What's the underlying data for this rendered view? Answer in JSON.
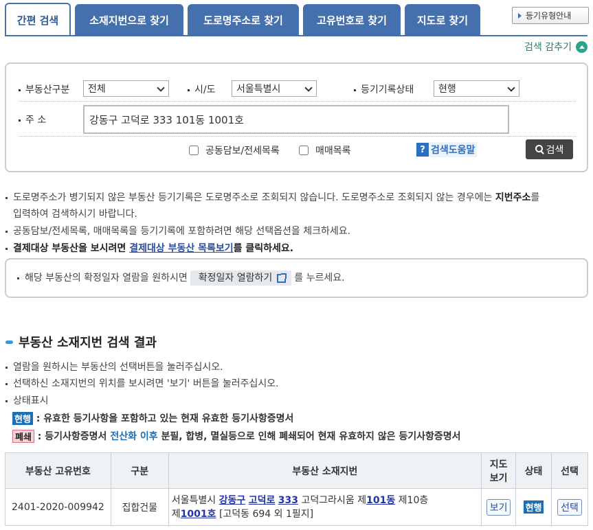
{
  "tabs": [
    {
      "label": "간편 검색"
    },
    {
      "label": "소재지번으로 찾기"
    },
    {
      "label": "도로명주소로 찾기"
    },
    {
      "label": "고유번호로 찾기"
    },
    {
      "label": "지도로 찾기"
    }
  ],
  "guide_button": "등기유형안내",
  "hide_search": "검색 감추기",
  "form": {
    "property_type_label": "부동산구분",
    "property_type_value": "전체",
    "sido_label": "시/도",
    "sido_value": "서울특별시",
    "record_status_label": "등기기록상태",
    "record_status_value": "현행",
    "address_label": "주 소",
    "address_value": "강동구 고덕로 333 101동 1001호",
    "check_joint": "공동담보/전세목록",
    "check_sale": "매매목록",
    "help_label": "검색도움말",
    "search_label": "검색"
  },
  "notes": {
    "n1a": "도로명주소가 병기되지 않은 부동산 등기기록은 도로명주소로 조회되지 않습니다. 도로명주소로 조회되지 않는 경우에는",
    "n1b": "지번주소",
    "n1c": "를",
    "n1d": "입력하여 검색하시기 바랍니다.",
    "n2": "공동담보/전세목록, 매매목록을 등기기록에 포함하려면 해당 선택옵션을 체크하세요.",
    "n3a": "결제대상 부동산을 보시려면",
    "n3link": "결제대상 부동산 목록보기",
    "n3b": "를 클릭하세요.",
    "confirm_pre": "해당 부동산의 확정일자 열람을 원하시면",
    "confirm_btn": "확정일자 열람하기",
    "confirm_post": "를 누르세요."
  },
  "results": {
    "title": "부동산 소재지번 검색 결과",
    "info1": "열람을 원하시는 부동산의 선택버튼을 눌러주십시오.",
    "info2": "선택하신 소재지번의 위치를 보시려면 '보기' 버튼을 눌러주십시오.",
    "info3": "상태표시",
    "legend_current_badge": "현행",
    "legend_current_text": ": 유효한 등기사항을 포함하고 있는 현재 유효한 등기사항증명서",
    "legend_closed_badge": "폐쇄",
    "legend_closed_pre": ": 등기사항증명서",
    "legend_closed_blue": "전산화 이후",
    "legend_closed_post": "분필, 합병, 멸실등으로 인해 폐쇄되어 현재 유효하지 않은 등기사항증명서",
    "headers": {
      "id": "부동산 고유번호",
      "kind": "구분",
      "address": "부동산 소재지번",
      "map_line1": "지도",
      "map_line2": "보기",
      "status": "상태",
      "select": "선택"
    },
    "row": {
      "id": "2401-2020-009942",
      "kind": "집합건물",
      "addr_city": "서울특별시",
      "addr_gu": "강동구",
      "addr_road": "고덕로",
      "addr_no": "333",
      "addr_bldg": "고덕그라시움 제",
      "addr_dong": "101동",
      "addr_floor": "제10층",
      "addr_je": "제",
      "addr_ho": "1001호",
      "addr_lot": "[고덕동 694 외 1필지]",
      "map_btn": "보기",
      "status_badge": "현행",
      "select_btn": "선택"
    }
  }
}
